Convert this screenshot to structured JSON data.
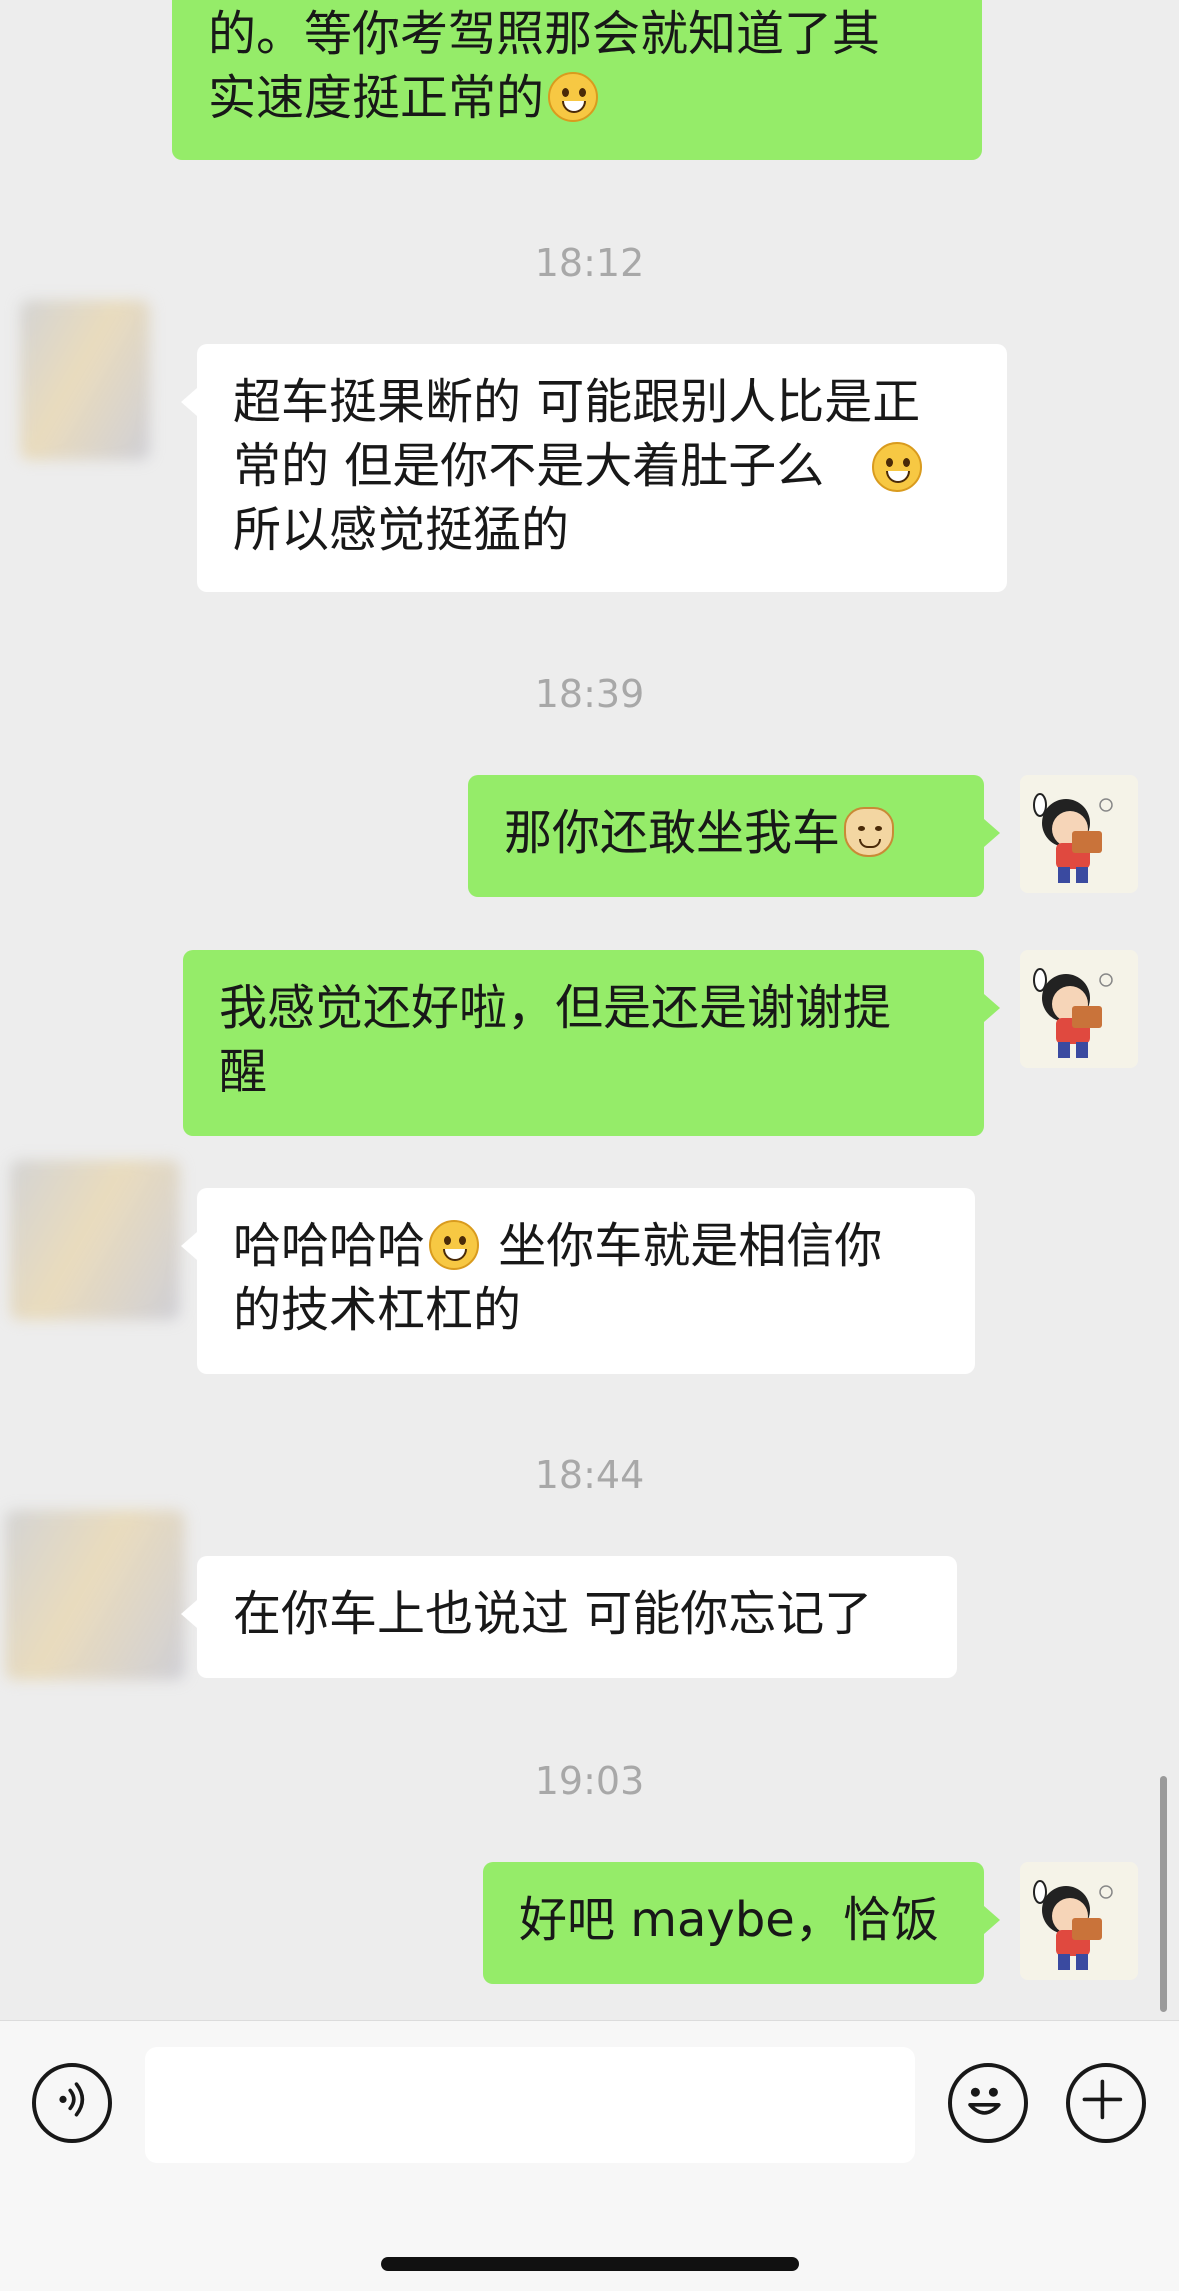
{
  "messages": {
    "m1": {
      "side": "out",
      "text": "的。等你考驾照那会就知道了其\n实速度挺正常的"
    },
    "t1": "18:12",
    "m2": {
      "side": "in",
      "text": "超车挺果断的 可能跟别人比是正\n常的 但是你不是大着肚子么\n所以感觉挺猛的"
    },
    "t2": "18:39",
    "m3": {
      "side": "out",
      "text": "那你还敢坐我车"
    },
    "m4": {
      "side": "out",
      "text": "我感觉还好啦，但是还是谢谢提\n醒"
    },
    "m5": {
      "side": "in",
      "text_a": "哈哈哈哈",
      "text_b": " 坐你车就是相信你\n的技术杠杠的"
    },
    "t3": "18:44",
    "m6": {
      "side": "in",
      "text": "在你车上也说过 可能你忘记了"
    },
    "t4": "19:03",
    "m7": {
      "side": "out",
      "text": "好吧 maybe，恰饭"
    }
  },
  "icons": {
    "voice": "voice-input-icon",
    "emoji": "emoji-smile-icon",
    "plus": "plus-icon",
    "face_cry": "face-with-tears-of-joy-icon",
    "cat": "cat-face-icon",
    "grin": "grinning-face-icon"
  },
  "colors": {
    "outgoing_bubble": "#95ec69",
    "incoming_bubble": "#ffffff",
    "chat_background": "#ededed",
    "timestamp": "#a8a8a8"
  }
}
